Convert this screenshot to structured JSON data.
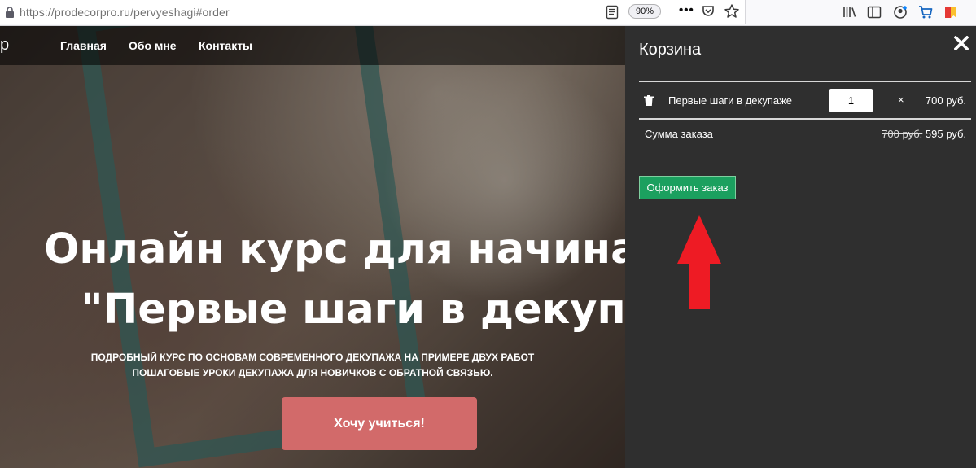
{
  "browser": {
    "url_host": "https://prodecorpro.ru",
    "url_path": "/pervyeshagi#order",
    "zoom": "90%",
    "toolbar_icons": [
      "library-icon",
      "sidebar-icon",
      "account-icon",
      "shopping-cart-icon",
      "bookmark-flag-icon"
    ]
  },
  "page": {
    "logo_fragment": "p",
    "nav": [
      "Главная",
      "Обо мне",
      "Контакты"
    ],
    "hero_title_line1": "Онлайн курс для начинающ",
    "hero_title_line2": "\"Первые шаги в декупаж",
    "hero_sub_line1": "ПОДРОБНЫЙ КУРС ПО ОСНОВАМ СОВРЕМЕННОГО ДЕКУПАЖА НА ПРИМЕРЕ ДВУХ РАБОТ",
    "hero_sub_line2": "ПОШАГОВЫЕ УРОКИ ДЕКУПАЖА ДЛЯ НОВИЧКОВ С ОБРАТНОЙ СВЯЗЬЮ.",
    "cta_label": "Хочу учиться!"
  },
  "cart": {
    "title": "Корзина",
    "items": [
      {
        "name": "Первые шаги в декупаже",
        "quantity": "1",
        "times": "×",
        "price": "700 руб."
      }
    ],
    "sum_label": "Сумма заказа",
    "sum_old": "700 руб.",
    "sum_new": "595 руб.",
    "checkout_label": "Оформить заказ"
  },
  "colors": {
    "cart_bg": "#2f2f2f",
    "checkout_green": "#1ba05f",
    "cta_red": "#d26a6a",
    "annotation_arrow": "#ee1b24"
  }
}
